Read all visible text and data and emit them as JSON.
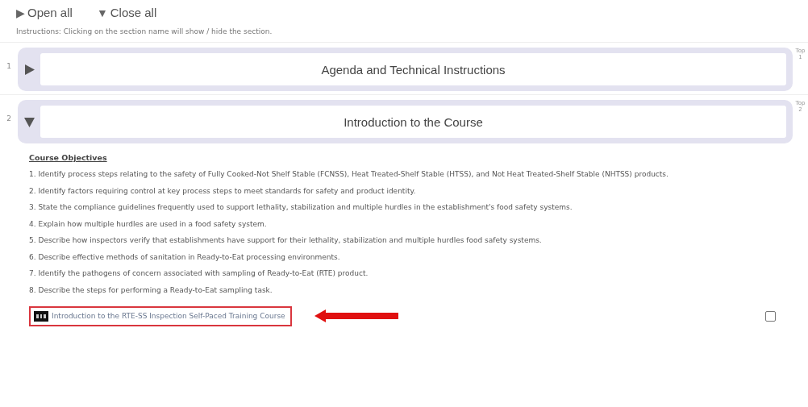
{
  "toolbar": {
    "open_all": {
      "icon": "▶",
      "label": "Open all"
    },
    "close_all": {
      "icon": "▼",
      "label": "Close all"
    }
  },
  "instructions": "Instructions: Clicking on the section name will show / hide the section.",
  "sections": [
    {
      "number": "1",
      "title": "Agenda and Technical Instructions",
      "expanded": false,
      "side_label": "Top",
      "side_number": "1"
    },
    {
      "number": "2",
      "title": "Introduction to the Course",
      "expanded": true,
      "side_label": "Top",
      "side_number": "2",
      "content": {
        "heading": "Course Objectives",
        "objectives": [
          "1. Identify process steps relating to the safety of Fully Cooked-Not Shelf Stable (FCNSS), Heat Treated-Shelf Stable (HTSS), and Not Heat Treated-Shelf Stable (NHTSS) products.",
          "2. Identify factors requiring control at key process steps to meet standards for safety and product identity.",
          "3. State the compliance guidelines frequently used to support lethality, stabilization and multiple hurdles in the establishment's food safety systems.",
          "4. Explain how multiple hurdles are used in a food safety system.",
          "5. Describe how inspectors verify that establishments have support for their lethality, stabilization and multiple hurdles food safety systems.",
          "6. Describe effective methods of sanitation in Ready-to-Eat processing environments.",
          "7. Identify the pathogens of concern associated with sampling of Ready-to-Eat (RTE) product.",
          "8. Describe the steps for performing a Ready-to-Eat sampling task."
        ],
        "link": {
          "label": "Introduction to the RTE-SS Inspection Self-Paced Training Course",
          "highlighted": true
        },
        "completion": {
          "checked": false
        }
      }
    }
  ]
}
